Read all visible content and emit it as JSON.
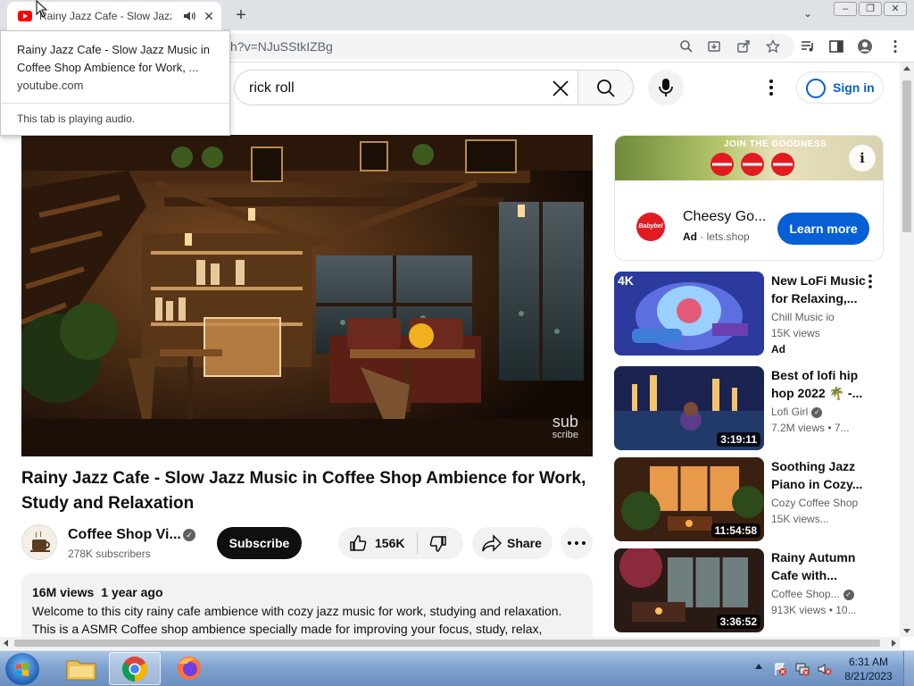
{
  "browser": {
    "tab_title": "Rainy Jazz Cafe - Slow Jazz M",
    "url_visible": "h?v=NJuSStkIZBg"
  },
  "hover_card": {
    "title": "Rainy Jazz Cafe - Slow Jazz Music in Coffee Shop Ambience for Work, ...",
    "domain": "youtube.com",
    "audio_status": "This tab is playing audio."
  },
  "masthead": {
    "search_query": "rick roll",
    "sign_in": "Sign in"
  },
  "player": {
    "watermark_line1": "sub",
    "watermark_line2": "scribe"
  },
  "video": {
    "title": "Rainy Jazz Cafe - Slow Jazz Music in Coffee Shop Ambience for Work, Study and Relaxation",
    "channel_name": "Coffee Shop Vi...",
    "subscribers": "278K subscribers",
    "subscribe_label": "Subscribe",
    "likes": "156K",
    "share_label": "Share",
    "views": "16M views",
    "age": "1 year ago",
    "description_line1": "Welcome to this city rainy cafe ambience with cozy jazz music for work, studying and relaxation.",
    "description_line2": "This is a ASMR Coffee shop ambience specially made for improving your focus, study, relax,"
  },
  "ad": {
    "banner_text": "JOIN THE GOODNESS",
    "logo_text": "Babybel",
    "title": "Cheesy Go...",
    "badge": "Ad",
    "domain": "lets.shop",
    "cta": "Learn more"
  },
  "recommendations": [
    {
      "title": "New LoFi Music for Relaxing,...",
      "channel": "Chill Music io",
      "meta": "15K views",
      "badge": "Ad",
      "thumb_label": "4K"
    },
    {
      "title": "Best of lofi hip hop 2022 🌴 -...",
      "channel": "Lofi Girl",
      "meta": "7.2M views  • 7...",
      "duration": "3:19:11"
    },
    {
      "title": "Soothing Jazz Piano in Cozy...",
      "channel": "Cozy Coffee Shop",
      "meta": "15K views...",
      "duration": "11:54:58"
    },
    {
      "title": "Rainy Autumn Cafe with...",
      "channel": "Coffee Shop...",
      "meta": "913K views  • 10...",
      "duration": "3:36:52"
    }
  ],
  "taskbar": {
    "time": "6:31 AM",
    "date": "8/21/2023"
  }
}
